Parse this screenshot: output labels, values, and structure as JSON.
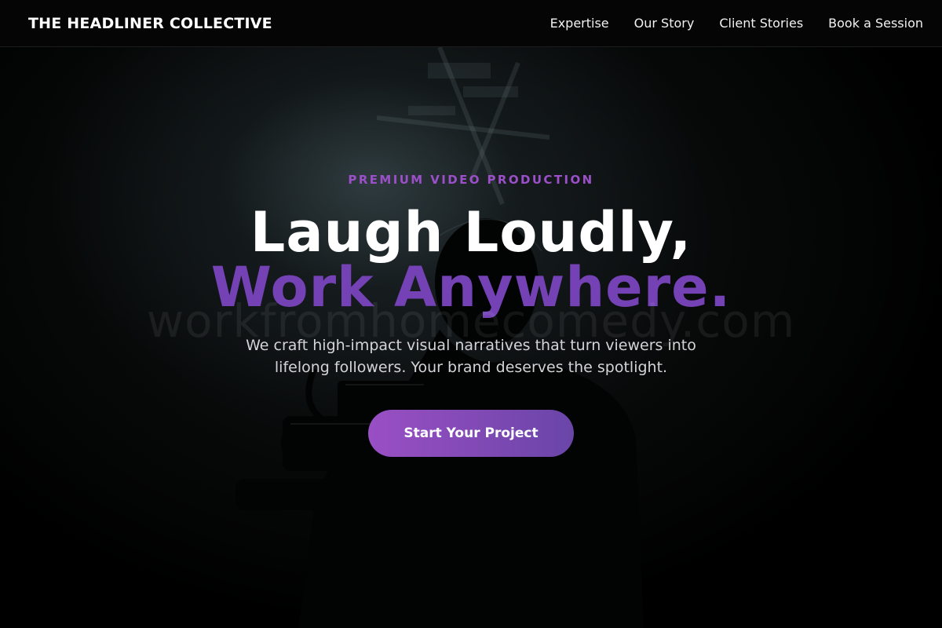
{
  "nav": {
    "logo": "THE HEADLINER COLLECTIVE",
    "links": [
      "Expertise",
      "Our Story",
      "Client Stories",
      "Book a Session"
    ]
  },
  "hero": {
    "eyebrow": "PREMIUM VIDEO PRODUCTION",
    "headline_line1": "Laugh Loudly,",
    "headline_line2": "Work Anywhere.",
    "watermark": "workfromhomecomedy.com",
    "subtitle": "We craft high-impact visual narratives that turn viewers into lifelong followers. Your brand deserves the spotlight.",
    "cta_label": "Start Your Project"
  },
  "colors": {
    "accent_purple": "#7442b5",
    "eyebrow_purple": "#9b4fc8",
    "cta_gradient_start": "#9a4fc4",
    "cta_gradient_end": "#6a45a8",
    "background": "#000000"
  }
}
